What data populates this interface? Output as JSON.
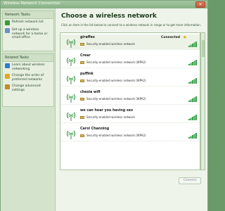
{
  "window": {
    "title": "Wireless Network Connection",
    "close_glyph": "×"
  },
  "sidebar": {
    "network_tasks_title": "Network Tasks",
    "network_tasks": [
      {
        "label": "Refresh network list",
        "icon": "refresh-icon",
        "color": "#3a9a3a"
      },
      {
        "label": "Set up a wireless network for a home or small office",
        "icon": "setup-wireless-icon",
        "color": "#6b8fc7"
      }
    ],
    "related_tasks_title": "Related Tasks",
    "related_tasks": [
      {
        "label": "Learn about wireless networking",
        "icon": "help-icon",
        "color": "#2e7bd0"
      },
      {
        "label": "Change the order of preferred networks",
        "icon": "star-icon",
        "color": "#e6a61c"
      },
      {
        "label": "Change advanced settings",
        "icon": "settings-icon",
        "color": "#c28a2c"
      }
    ]
  },
  "main": {
    "title": "Choose a wireless network",
    "description": "Click an item in the list below to connect to a wireless network in range or to get more information."
  },
  "networks": [
    {
      "name": "giraffes",
      "security": "Security-enabled wireless network",
      "status": "Connected",
      "starred": true
    },
    {
      "name": "Crear",
      "security": "Security-enabled wireless network (WPA2)",
      "status": "",
      "starred": false
    },
    {
      "name": "puffink",
      "security": "Security-enabled wireless network (WPA2)",
      "status": "",
      "starred": false
    },
    {
      "name": "chesia wifi",
      "security": "Security-enabled wireless network (WPA2)",
      "status": "",
      "starred": false
    },
    {
      "name": "we can hear you having sex",
      "security": "Security-enabled wireless network",
      "status": "",
      "starred": false
    },
    {
      "name": "Carol Channing",
      "security": "Security-enabled wireless network (WPA2)",
      "status": "",
      "starred": false
    }
  ],
  "footer": {
    "connect_label": "Connect"
  }
}
